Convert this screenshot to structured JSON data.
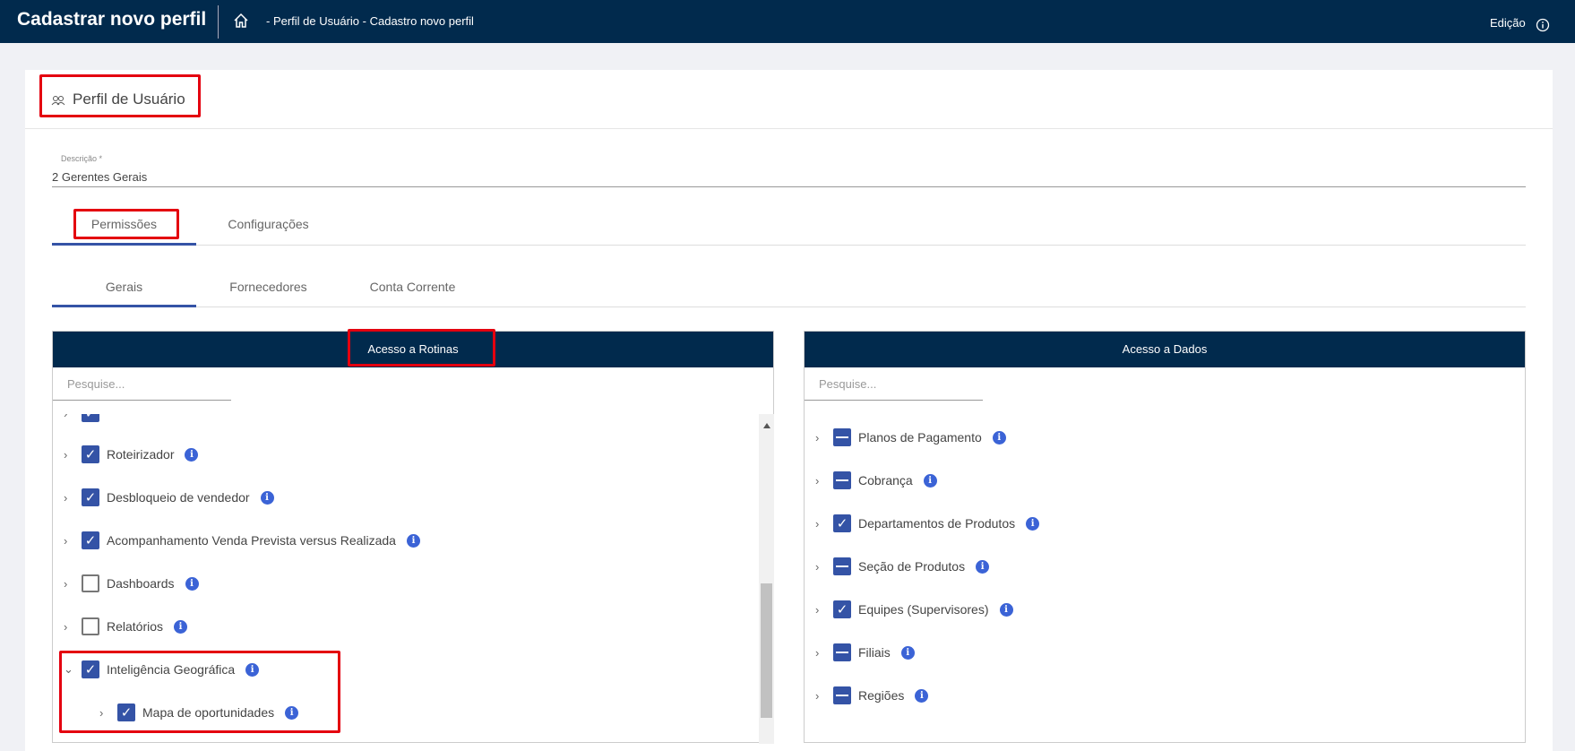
{
  "header": {
    "title": "Cadastrar novo perfil",
    "breadcrumb": "- Perfil de Usuário - Cadastro novo perfil",
    "mode": "Edição"
  },
  "card": {
    "title": "Perfil de Usuário",
    "description_label": "Descrição *",
    "description_value": "2  Gerentes Gerais"
  },
  "tabs": [
    {
      "label": "Permissões",
      "active": true
    },
    {
      "label": "Configurações",
      "active": false
    }
  ],
  "subtabs": [
    {
      "label": "Gerais",
      "active": true
    },
    {
      "label": "Fornecedores",
      "active": false
    },
    {
      "label": "Conta Corrente",
      "active": false
    }
  ],
  "routines": {
    "title": "Acesso a Rotinas",
    "search_placeholder": "Pesquise...",
    "items": [
      {
        "label": "Roteirizador",
        "state": "checked",
        "expanded": false
      },
      {
        "label": "Desbloqueio de vendedor",
        "state": "checked",
        "expanded": false
      },
      {
        "label": "Acompanhamento Venda Prevista versus Realizada",
        "state": "checked",
        "expanded": false
      },
      {
        "label": "Dashboards",
        "state": "unchecked",
        "expanded": false
      },
      {
        "label": "Relatórios",
        "state": "unchecked",
        "expanded": false
      },
      {
        "label": "Inteligência Geográfica",
        "state": "checked",
        "expanded": true
      },
      {
        "label": "Mapa de oportunidades",
        "state": "checked",
        "expanded": false,
        "child": true
      }
    ]
  },
  "data_access": {
    "title": "Acesso a Dados",
    "search_placeholder": "Pesquise...",
    "items": [
      {
        "label": "Planos de Pagamento",
        "state": "indeterminate"
      },
      {
        "label": "Cobrança",
        "state": "indeterminate"
      },
      {
        "label": "Departamentos de Produtos",
        "state": "checked"
      },
      {
        "label": "Seção de Produtos",
        "state": "indeterminate"
      },
      {
        "label": "Equipes (Supervisores)",
        "state": "checked"
      },
      {
        "label": "Filiais",
        "state": "indeterminate"
      },
      {
        "label": "Regiões",
        "state": "indeterminate"
      }
    ]
  },
  "colors": {
    "header_bg": "#012a4d",
    "accent": "#3453a6",
    "highlight": "#e4000f"
  }
}
